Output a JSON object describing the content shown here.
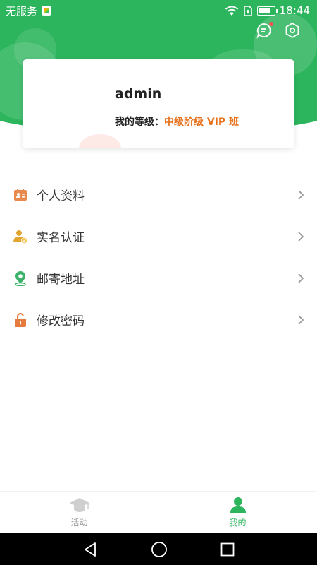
{
  "status_bar": {
    "carrier": "无服务",
    "time": "18:44",
    "battery_level": 0.75
  },
  "profile": {
    "username": "admin",
    "level_label": "我的等级：",
    "level_value": "中级阶级 VIP 班"
  },
  "menu": {
    "items": [
      {
        "label": "个人资料",
        "icon": "id-card-icon",
        "color": "#e88a4d"
      },
      {
        "label": "实名认证",
        "icon": "verified-user-icon",
        "color": "#e2a531"
      },
      {
        "label": "邮寄地址",
        "icon": "location-pin-icon",
        "color": "#3bb36a"
      },
      {
        "label": "修改密码",
        "icon": "lock-icon",
        "color": "#e57b3d"
      }
    ]
  },
  "tabs": [
    {
      "label": "活动",
      "icon": "graduation-cap-icon",
      "active": false
    },
    {
      "label": "我的",
      "icon": "person-icon",
      "active": true
    }
  ],
  "colors": {
    "brand_green": "#2db55d",
    "accent_orange": "#e8721c"
  }
}
